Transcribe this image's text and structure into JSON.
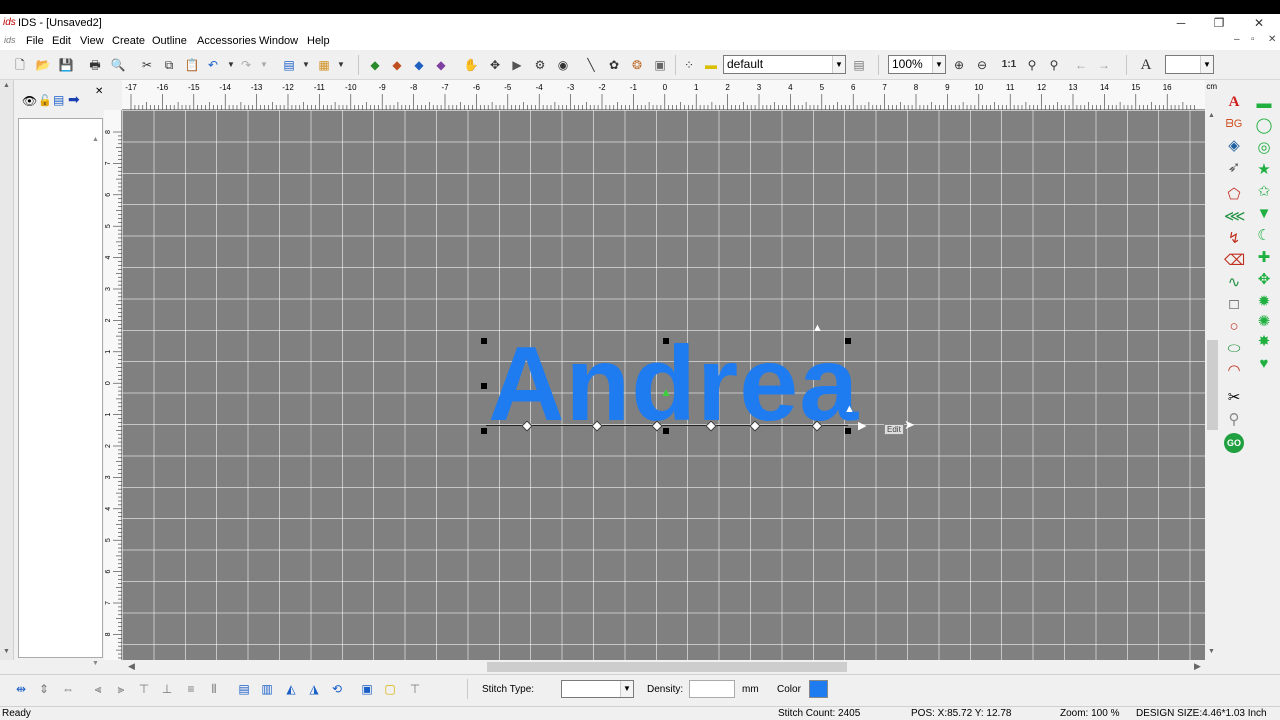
{
  "window": {
    "logo": "ids",
    "title": "IDS - [Unsaved2]"
  },
  "menu": [
    "File",
    "Edit",
    "View",
    "Create",
    "Outline",
    "Accessories",
    "Window",
    "Help"
  ],
  "toolbar": {
    "color_table": "default",
    "zoom": "100%",
    "font_box": ""
  },
  "hruler": [
    "-17",
    "-16",
    "-15",
    "-14",
    "-13",
    "-12",
    "-11",
    "-10",
    "-9",
    "-8",
    "-7",
    "-6",
    "-5",
    "-4",
    "-3",
    "-2",
    "-1",
    "0",
    "1",
    "2",
    "3",
    "4",
    "5",
    "6",
    "7",
    "8",
    "9",
    "10",
    "11",
    "12",
    "13",
    "14",
    "15",
    "16"
  ],
  "hruler_unit": "cm",
  "vruler": [
    "8",
    "7",
    "6",
    "5",
    "4",
    "3",
    "2",
    "1",
    "0",
    "1",
    "2",
    "3",
    "4",
    "5",
    "6",
    "7",
    "8"
  ],
  "design": {
    "text": "Andrea",
    "color": "#1e7bf0",
    "tooltip": "Edit"
  },
  "bottom": {
    "stitch_type_label": "Stitch Type:",
    "stitch_type_value": "",
    "density_label": "Density:",
    "density_value": "",
    "density_unit": "mm",
    "color_label": "Color",
    "color_swatch": "#1e7bf0"
  },
  "status": {
    "ready": "Ready",
    "stitch_count": "Stitch Count: 2405",
    "pos": "POS: X:85.72    Y: 12.78",
    "zoom": "Zoom: 100 %",
    "design_size": "DESIGN SIZE:4.46*1.03 Inch"
  },
  "icons": [
    "new-icon",
    "open-icon",
    "save-icon",
    "print-icon",
    "preview-icon",
    "cut-icon",
    "copy-icon",
    "paste-icon",
    "undo-icon",
    "redo-icon"
  ]
}
